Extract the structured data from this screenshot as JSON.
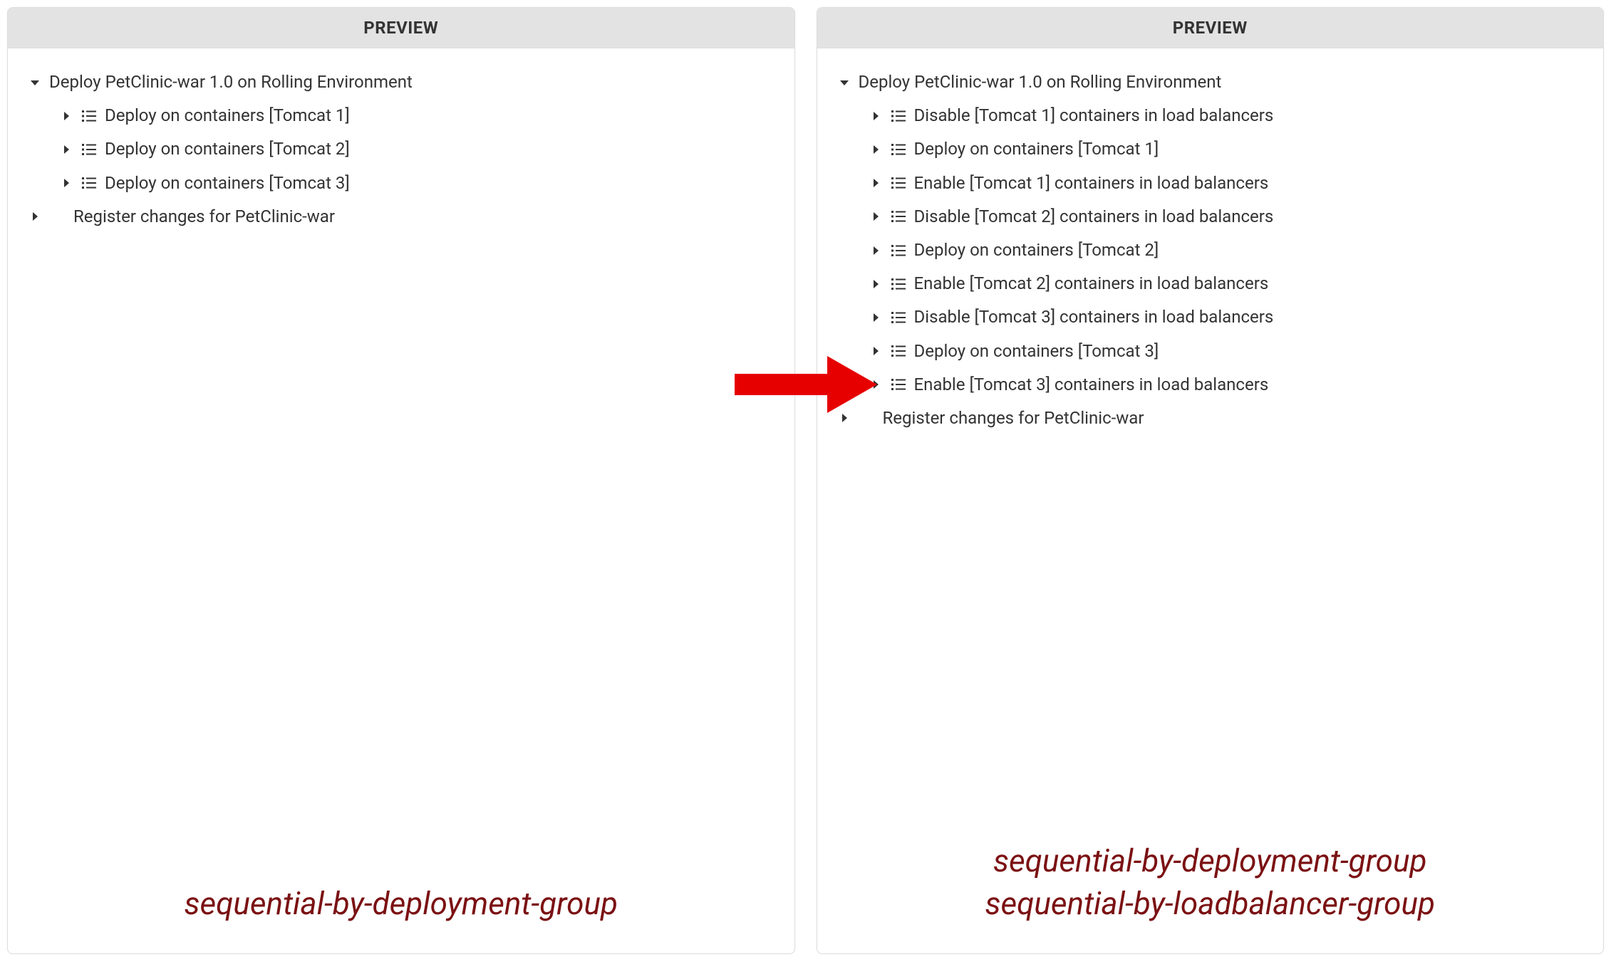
{
  "panels": {
    "left": {
      "header": "PREVIEW",
      "tree": [
        {
          "level": 0,
          "expanded": true,
          "hasListIcon": false,
          "label": "Deploy PetClinic-war 1.0 on Rolling Environment"
        },
        {
          "level": 1,
          "expanded": false,
          "hasListIcon": true,
          "label": "Deploy on containers [Tomcat 1]"
        },
        {
          "level": 1,
          "expanded": false,
          "hasListIcon": true,
          "label": "Deploy on containers [Tomcat 2]"
        },
        {
          "level": 1,
          "expanded": false,
          "hasListIcon": true,
          "label": "Deploy on containers [Tomcat 3]"
        },
        {
          "level": 0,
          "expanded": false,
          "hasListIcon": false,
          "label": "Register changes for PetClinic-war"
        }
      ],
      "captions": [
        "sequential-by-deployment-group"
      ]
    },
    "right": {
      "header": "PREVIEW",
      "tree": [
        {
          "level": 0,
          "expanded": true,
          "hasListIcon": false,
          "label": "Deploy PetClinic-war 1.0 on Rolling Environment"
        },
        {
          "level": 1,
          "expanded": false,
          "hasListIcon": true,
          "label": "Disable [Tomcat 1] containers in load balancers"
        },
        {
          "level": 1,
          "expanded": false,
          "hasListIcon": true,
          "label": "Deploy on containers [Tomcat 1]"
        },
        {
          "level": 1,
          "expanded": false,
          "hasListIcon": true,
          "label": "Enable [Tomcat 1] containers in load balancers"
        },
        {
          "level": 1,
          "expanded": false,
          "hasListIcon": true,
          "label": "Disable [Tomcat 2] containers in load balancers"
        },
        {
          "level": 1,
          "expanded": false,
          "hasListIcon": true,
          "label": "Deploy on containers [Tomcat 2]"
        },
        {
          "level": 1,
          "expanded": false,
          "hasListIcon": true,
          "label": "Enable [Tomcat 2] containers in load balancers"
        },
        {
          "level": 1,
          "expanded": false,
          "hasListIcon": true,
          "label": "Disable [Tomcat 3] containers in load balancers"
        },
        {
          "level": 1,
          "expanded": false,
          "hasListIcon": true,
          "label": "Deploy on containers [Tomcat 3]"
        },
        {
          "level": 1,
          "expanded": false,
          "hasListIcon": true,
          "label": "Enable [Tomcat 3] containers in load balancers"
        },
        {
          "level": 0,
          "expanded": false,
          "hasListIcon": false,
          "label": "Register changes for PetClinic-war"
        }
      ],
      "captions": [
        "sequential-by-deployment-group",
        "sequential-by-loadbalancer-group"
      ]
    }
  },
  "colors": {
    "arrow": "#e60000",
    "caption": "#7b1113"
  }
}
